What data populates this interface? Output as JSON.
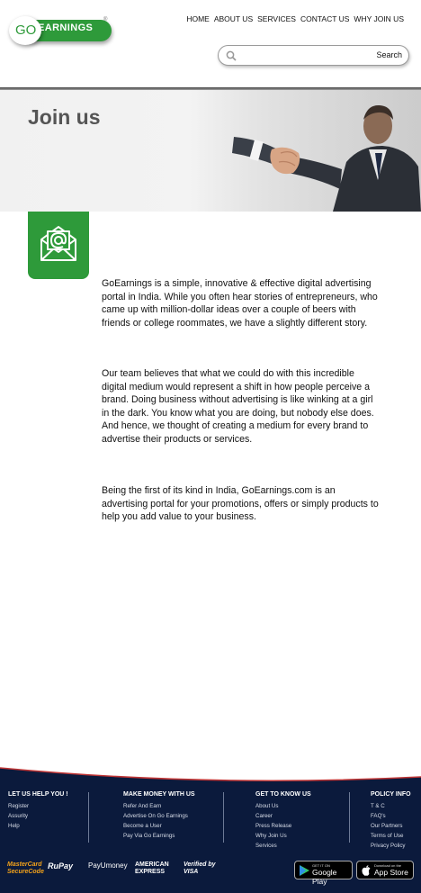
{
  "brand": {
    "logo_go": "GO",
    "logo_rest": "EARNINGS",
    "tm": "®",
    "color": "#2e9a3a"
  },
  "nav": [
    "HOME",
    "ABOUT US",
    "SERVICES",
    "CONTACT US",
    "WHY JOIN US"
  ],
  "search": {
    "placeholder": "",
    "value": "",
    "button": "Search",
    "icon": "magnifier-icon"
  },
  "banner": {
    "title": "Join us"
  },
  "content": {
    "icon": "email-at-icon",
    "paragraphs": [
      "GoEarnings is a simple, innovative & effective digital advertising portal in India. While you often hear stories of entrepreneurs, who came up with million-dollar ideas over a couple of beers with friends or college roommates, we have a slightly different story.",
      "Our team believes that what we could do with this incredible digital medium would represent a shift in how people perceive a brand. Doing business without advertising is like winking at a girl in the dark. You know what you are doing, but nobody else does. And hence, we thought of creating a medium for every brand to advertise their products or services.",
      "Being the first of its kind in India, GoEarnings.com is an advertising portal for your promotions, offers or simply products to help you add value to your business."
    ]
  },
  "footer": {
    "columns": [
      {
        "title": "LET US HELP YOU !",
        "items": [
          "Register",
          "Assurity",
          "Help"
        ]
      },
      {
        "title": "MAKE MONEY WITH US",
        "items": [
          "Refer And Earn",
          "Advertise On Go Earnings",
          "Become a User",
          "Pay Via Go Earnings"
        ]
      },
      {
        "title": "GET TO KNOW US",
        "items": [
          "About Us",
          "Career",
          "Press Release",
          "Why Join Us",
          "Services"
        ]
      },
      {
        "title": "POLICY INFO",
        "items": [
          "T & C",
          "FAQ's",
          "Our Partners",
          "Terms of Use",
          "Privacy Policy"
        ]
      }
    ],
    "payments": [
      "MasterCard SecureCode",
      "RuPay",
      "PayUmoney",
      "AMERICAN EXPRESS",
      "Verified by VISA"
    ],
    "stores": [
      {
        "small": "GET IT ON",
        "big": "Google Play"
      },
      {
        "small": "Download on the",
        "big": "App Store"
      }
    ]
  }
}
